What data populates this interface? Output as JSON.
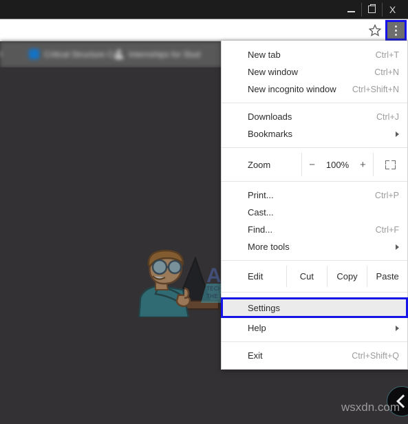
{
  "window": {
    "controls": [
      {
        "name": "minimize",
        "glyph": "minimize-icon"
      },
      {
        "name": "restore",
        "glyph": "restore-icon"
      },
      {
        "name": "close",
        "glyph": "close-icon",
        "label": "X"
      }
    ]
  },
  "toolbar": {
    "bookmark_star": "star-icon",
    "menu_button": "three-dot-menu-icon",
    "highlight_color": "#1414e8"
  },
  "bookmarks_bar": {
    "items": [
      {
        "label": "Critical Structure Co",
        "icon": "blue-square-favicon"
      },
      {
        "label": "Internships for Stud",
        "icon": "person-favicon"
      }
    ]
  },
  "page": {
    "background_color": "#333133",
    "watermark_brand": "APPUALS",
    "watermark_tagline_line1": "TECH HOW-TO'S FROM",
    "watermark_tagline_line2": "THE EXPERTS",
    "site_watermark": "wsxdn.com",
    "edge_button": "back-chevron-icon"
  },
  "menu": {
    "groups": [
      {
        "items": [
          {
            "label": "New tab",
            "accel": "Ctrl+T",
            "name": "menu-item-new-tab"
          },
          {
            "label": "New window",
            "accel": "Ctrl+N",
            "name": "menu-item-new-window"
          },
          {
            "label": "New incognito window",
            "accel": "Ctrl+Shift+N",
            "name": "menu-item-new-incognito-window"
          }
        ]
      },
      {
        "items": [
          {
            "label": "Downloads",
            "accel": "Ctrl+J",
            "name": "menu-item-downloads"
          },
          {
            "label": "Bookmarks",
            "accel": "",
            "submenu": true,
            "name": "menu-item-bookmarks"
          }
        ]
      }
    ],
    "zoom": {
      "label": "Zoom",
      "minus": "−",
      "level": "100%",
      "plus": "+",
      "fullscreen_icon": "fullscreen-icon"
    },
    "group3": [
      {
        "label": "Print...",
        "accel": "Ctrl+P",
        "name": "menu-item-print"
      },
      {
        "label": "Cast...",
        "accel": "",
        "name": "menu-item-cast"
      },
      {
        "label": "Find...",
        "accel": "Ctrl+F",
        "name": "menu-item-find"
      },
      {
        "label": "More tools",
        "accel": "",
        "submenu": true,
        "name": "menu-item-more-tools"
      }
    ],
    "edit": {
      "label": "Edit",
      "cut": "Cut",
      "copy": "Copy",
      "paste": "Paste"
    },
    "settings": {
      "label": "Settings",
      "highlighted": true,
      "highlight_color": "#1414e8"
    },
    "help": {
      "label": "Help",
      "submenu": true
    },
    "exit": {
      "label": "Exit",
      "accel": "Ctrl+Shift+Q"
    }
  }
}
